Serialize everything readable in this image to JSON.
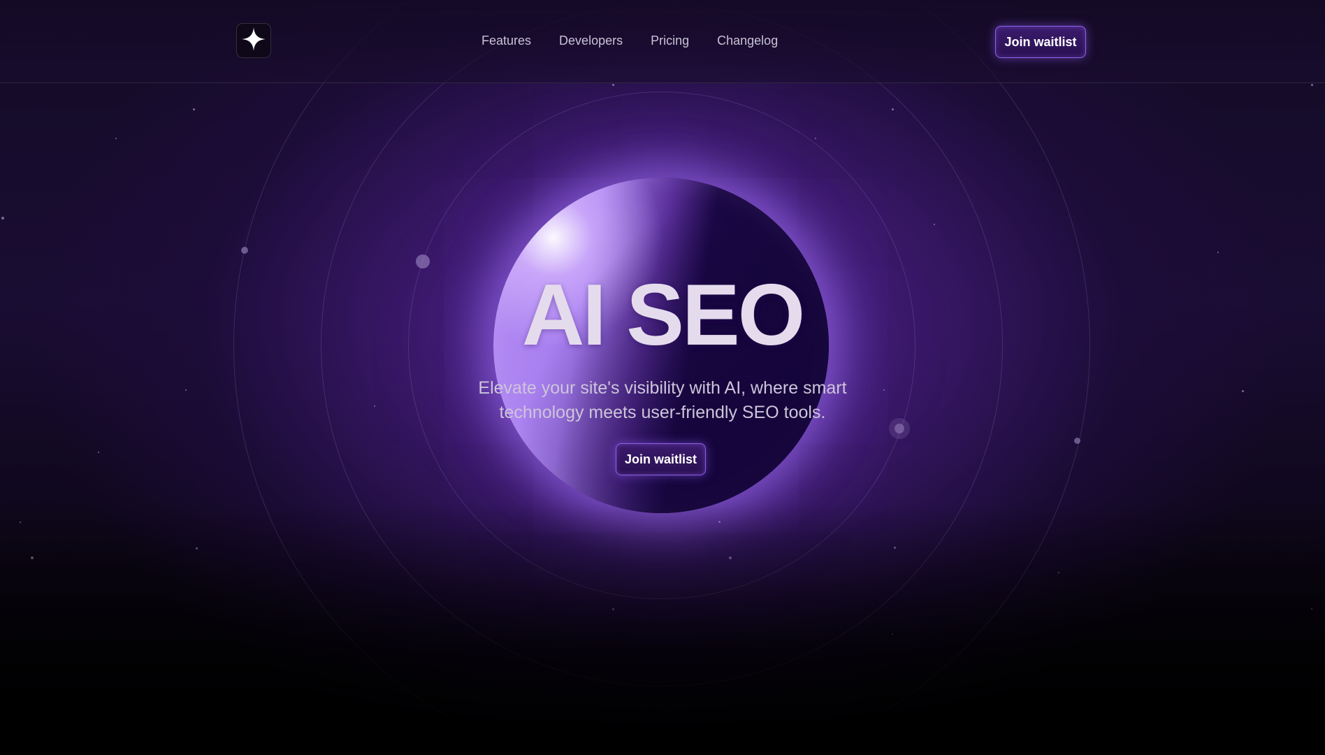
{
  "header": {
    "logo_icon": "sparkle-icon",
    "nav": [
      {
        "label": "Features"
      },
      {
        "label": "Developers"
      },
      {
        "label": "Pricing"
      },
      {
        "label": "Changelog"
      }
    ],
    "cta_label": "Join waitlist"
  },
  "hero": {
    "title": "AI SEO",
    "subtitle": "Elevate your site's visibility with AI, where smart technology meets user-friendly SEO tools.",
    "cta_label": "Join waitlist"
  },
  "theme": {
    "accent": "#8e62e8",
    "background": "#140b26",
    "planet_glow": "#b58cf2"
  }
}
